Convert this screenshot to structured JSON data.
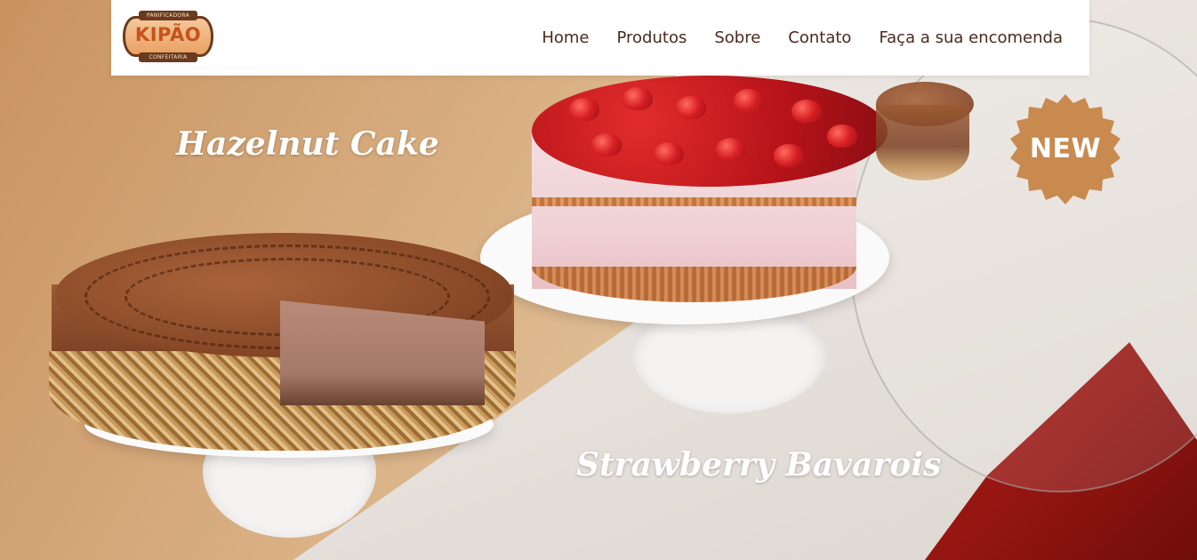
{
  "brand": {
    "name": "KIPÃO",
    "top_label": "PANIFICADORA",
    "bottom_label": "CONFEITARIA"
  },
  "nav": {
    "items": [
      {
        "label": "Home"
      },
      {
        "label": "Produtos"
      },
      {
        "label": "Sobre"
      },
      {
        "label": "Contato"
      },
      {
        "label": "Faça a sua encomenda"
      }
    ]
  },
  "hero": {
    "product_left": "Hazelnut Cake",
    "product_right": "Strawberry Bavarois",
    "badge": "NEW"
  },
  "colors": {
    "nav_text": "#4a2a1c",
    "badge": "#c88a4f",
    "logo_orange": "#c7521c"
  }
}
